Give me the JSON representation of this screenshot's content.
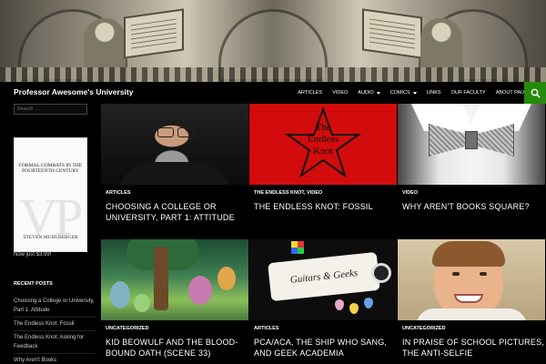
{
  "site": {
    "title": "Professor Awesome's University"
  },
  "nav": {
    "items": [
      {
        "label": "ARTICLES",
        "has_dropdown": false
      },
      {
        "label": "VIDEO",
        "has_dropdown": false
      },
      {
        "label": "AUDIO",
        "has_dropdown": true
      },
      {
        "label": "COMICS",
        "has_dropdown": true
      },
      {
        "label": "LINKS",
        "has_dropdown": false
      },
      {
        "label": "OUR FACULTY",
        "has_dropdown": false
      },
      {
        "label": "ABOUT PAU",
        "has_dropdown": false
      }
    ],
    "search_icon": "search-icon",
    "accent_color": "#24890d"
  },
  "sidebar": {
    "search_placeholder": "Search …",
    "book": {
      "title": "FORMAL COMBATS IN THE FOURTEENTH CENTURY",
      "mark": "VP",
      "author": "STEVEN MUHLBERGER"
    },
    "price": "Now just $3.99!",
    "recent_heading": "RECENT POSTS",
    "recent_posts": [
      "Choosing a College or University, Part 1: Attitude",
      "The Endless Knot: Fossil",
      "The Endless Knot: Asking for Feedback",
      "Why Aren't Books"
    ]
  },
  "posts": [
    {
      "category": "ARTICLES",
      "title": "CHOOSING A COLLEGE OR UNIVERSITY, PART 1: ATTITUDE"
    },
    {
      "category": "THE ENDLESS KNOT, VIDEO",
      "title": "THE ENDLESS KNOT: FOSSIL",
      "image_text": [
        "The",
        "Endless",
        "Knot"
      ]
    },
    {
      "category": "VIDEO",
      "title": "WHY AREN'T BOOKS SQUARE?"
    },
    {
      "category": "UNCATEGORIZED",
      "title": "KID BEOWULF AND THE BLOOD-BOUND OATH (SCENE 33)"
    },
    {
      "category": "ARTICLES",
      "title": "PCA/ACA, THE SHIP WHO SANG, AND GEEK ACADEMIA",
      "image_text": "Guitars & Geeks"
    },
    {
      "category": "UNCATEGORIZED",
      "title": "IN PRAISE OF SCHOOL PICTURES, THE ANTI-SELFIE"
    }
  ]
}
